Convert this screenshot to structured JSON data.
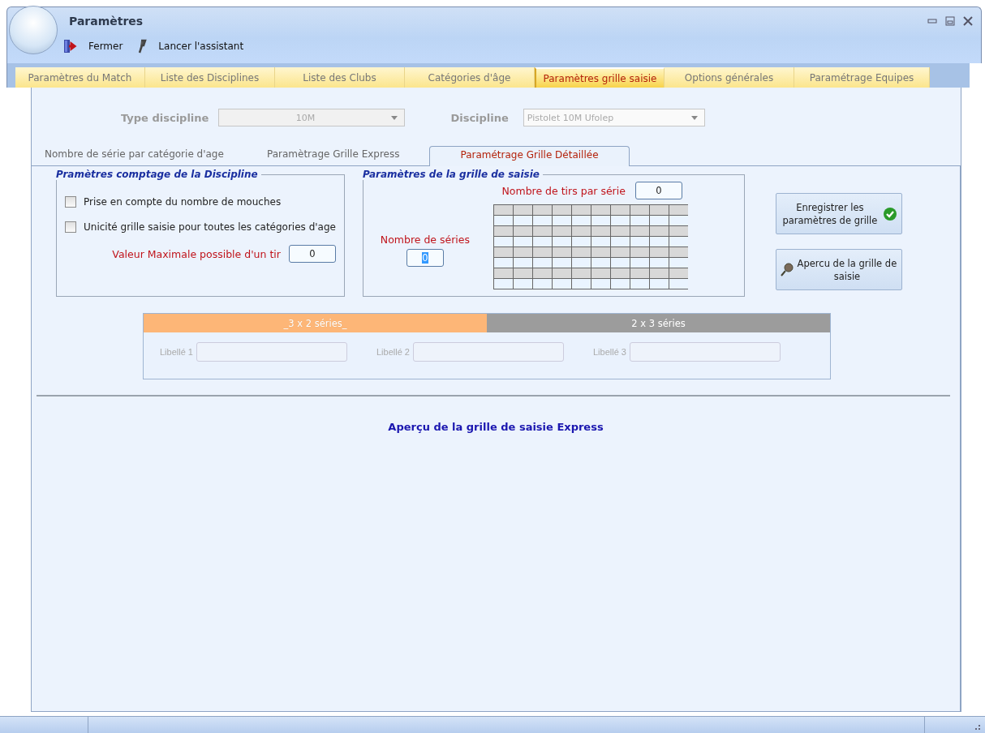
{
  "window": {
    "title": "Paramètres"
  },
  "toolbar": [
    {
      "label": "Fermer",
      "kind": "exit"
    },
    {
      "label": "Lancer l'assistant",
      "kind": "wizard"
    }
  ],
  "main_tabs": [
    {
      "label": "Paramètres du Match",
      "selected": false
    },
    {
      "label": "Liste des Disciplines",
      "selected": false
    },
    {
      "label": "Liste des Clubs",
      "selected": false
    },
    {
      "label": "Catégories d'âge",
      "selected": false
    },
    {
      "label": "Paramètres grille saisie",
      "selected": true
    },
    {
      "label": "Options générales",
      "selected": false
    },
    {
      "label": "Paramétrage Equipes",
      "selected": false
    }
  ],
  "filters": [
    {
      "label": "Type discipline",
      "value": "10M",
      "disabled": true
    },
    {
      "label": "Discipline",
      "value": "Pistolet 10M Ufolep",
      "disabled": true
    }
  ],
  "sub_tabs": [
    {
      "label": "Nombre de série par catégorie d'age",
      "selected": false
    },
    {
      "label": "Paramètrage Grille Express",
      "selected": false
    },
    {
      "label": "Paramétrage Grille Détaillée",
      "selected": true
    }
  ],
  "counting_group": {
    "title": "Pramètres comptage de la Discipline",
    "checkboxes": [
      {
        "label": "Prise en compte du nombre de mouches",
        "checked": false
      },
      {
        "label": "Unicité grille saisie pour toutes les catégories d'age",
        "checked": false
      }
    ],
    "max_value": {
      "label": "Valeur Maximale possible d'un tir",
      "value": "0"
    }
  },
  "grid_group": {
    "title": "Paramètres de la grille de saisie",
    "shots_per_series": {
      "label": "Nombre de tirs par série",
      "value": "0",
      "highlighted": false
    },
    "series_count": {
      "label": "Nombre de séries",
      "value": "0",
      "highlighted": true
    }
  },
  "actions": [
    {
      "label": "Enregistrer les paramètres de grille",
      "kind": "save"
    },
    {
      "label": "Apercu de la grille de saisie",
      "kind": "preview"
    }
  ],
  "layout_options": [
    {
      "label": "_3 x 2 séries_",
      "selected": true
    },
    {
      "label": "2 x 3 séries",
      "selected": false
    }
  ],
  "label_fields": [
    {
      "label": "Libellé 1",
      "disabled": true
    },
    {
      "label": "Libellé 2",
      "disabled": true
    },
    {
      "label": "Libellé 3",
      "disabled": true
    }
  ],
  "preview_title": "Aperçu de la grille de saisie Express"
}
